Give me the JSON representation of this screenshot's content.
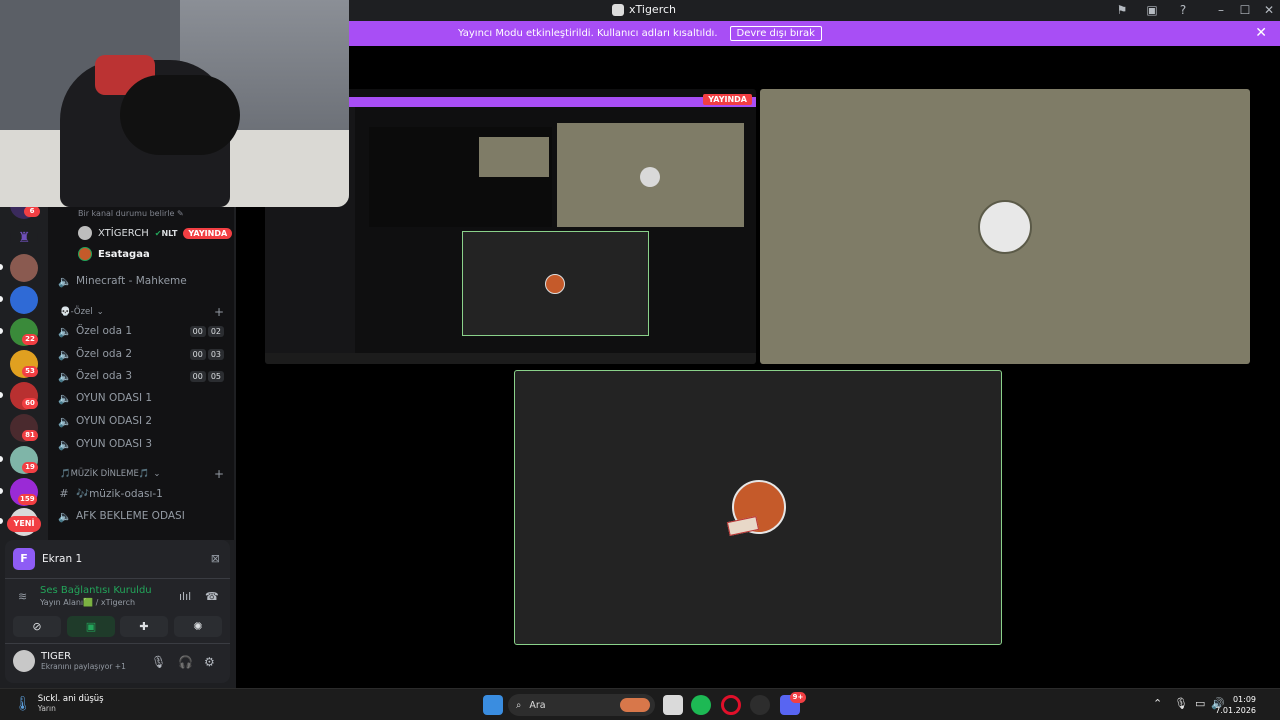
{
  "window": {
    "title": "xTigerch"
  },
  "banner": {
    "message": "Yayıncı Modu etkinleştirildi. Kullanıcı adları kısaltıldı.",
    "disable_label": "Devre dışı bırak"
  },
  "rail": {
    "badges": [
      "6",
      "22",
      "53",
      "60",
      "81",
      "19",
      "159"
    ],
    "new_label": "YENİ"
  },
  "channel_list": {
    "status_prompt": "Bir kanal durumu belirle",
    "members": [
      {
        "name": "XTİGERCH",
        "tag": "NLT",
        "live_label": "YAYINDA"
      },
      {
        "name": "Esatagaa"
      }
    ],
    "voice_channels_top": [
      {
        "name": "Minecraft - Mahkeme"
      }
    ],
    "category_private": "💀-Özel",
    "private_rooms": [
      {
        "name": "Özel oda 1",
        "count": "00",
        "limit": "02"
      },
      {
        "name": "Özel oda 2",
        "count": "00",
        "limit": "03"
      },
      {
        "name": "Özel oda 3",
        "count": "00",
        "limit": "05"
      }
    ],
    "game_rooms": [
      "OYUN ODASI 1",
      "OYUN ODASI 2",
      "OYUN ODASI 3"
    ],
    "category_music": "🎵MÜZİK DİNLEME🎵",
    "text_channel": "🎶müzik-odası-1",
    "afk_channel": "AFK BEKLEME ODASI"
  },
  "panel": {
    "screen_label": "Ekran 1",
    "screen_icon_letter": "F",
    "voice_status": "Ses Bağlantısı Kuruldu",
    "voice_sub": "Yayın Alanı🟩 / xTigerch",
    "user": {
      "name": "TIGER",
      "status": "Ekranını paylaşıyor +1"
    }
  },
  "stage": {
    "live_label": "YAYINDA"
  },
  "taskbar": {
    "weather_title": "Sıckl. ani düşüş",
    "weather_sub": "Yarın",
    "search_placeholder": "Ara",
    "time": "01:09",
    "date": "7.01.2026",
    "discord_badge": "9+"
  },
  "colors": {
    "banner": "#a84ef5",
    "live_red": "#f23f43",
    "voice_green": "#23a55a",
    "focus_border": "#8ad18a"
  }
}
